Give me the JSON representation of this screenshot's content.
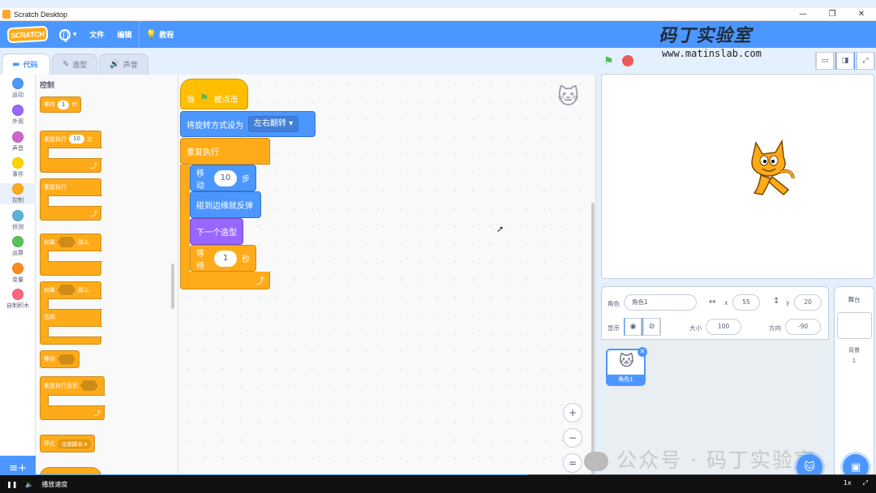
{
  "window": {
    "title": "Scratch Desktop",
    "controls": [
      "—",
      "❐",
      "✕"
    ]
  },
  "menubar": {
    "logo": "SCRATCH",
    "file": "文件",
    "edit": "编辑",
    "tutorials": "教程"
  },
  "watermark": {
    "brand": "码丁实验室",
    "url": "www.matinslab.com",
    "bottom": "公众号 · 码丁实验室"
  },
  "tabs": [
    {
      "label": "代码",
      "icon": "code-icon",
      "active": true
    },
    {
      "label": "造型",
      "icon": "brush-icon",
      "active": false
    },
    {
      "label": "声音",
      "icon": "speaker-icon",
      "active": false
    }
  ],
  "categories": [
    {
      "label": "运动",
      "color": "#4c97ff"
    },
    {
      "label": "外观",
      "color": "#9966ff"
    },
    {
      "label": "声音",
      "color": "#cf63cf"
    },
    {
      "label": "事件",
      "color": "#ffd500"
    },
    {
      "label": "控制",
      "color": "#ffab19"
    },
    {
      "label": "侦测",
      "color": "#5cb1d6"
    },
    {
      "label": "运算",
      "color": "#59c059"
    },
    {
      "label": "变量",
      "color": "#ff8c1a"
    },
    {
      "label": "自制积木",
      "color": "#ff6680"
    }
  ],
  "palette": {
    "title": "控制",
    "wait_label": "等待",
    "wait_value": "1",
    "wait_unit": "秒",
    "repeat_label": "重复执行",
    "repeat_value": "10",
    "repeat_unit": "次",
    "forever_label": "重复执行",
    "if_label": "如果",
    "then_label": "那么",
    "if2_label": "如果",
    "then2_label": "那么",
    "else_label": "否则",
    "wait_until_label": "等待",
    "repeat_until_label": "重复执行直到",
    "stop_label": "停止",
    "stop_option": "全部脚本"
  },
  "script": {
    "when_label": "当",
    "clicked_label": "被点击",
    "rotation_label": "将旋转方式设为",
    "rotation_option": "左右翻转",
    "forever_label": "重复执行",
    "move_label": "移动",
    "move_value": "10",
    "move_unit": "步",
    "bounce_label": "碰到边缘就反弹",
    "next_costume_label": "下一个造型",
    "wait_label": "等待",
    "wait_value": "1",
    "wait_unit": "秒"
  },
  "zoom": {
    "in": "+",
    "out": "−",
    "reset": "="
  },
  "sprite": {
    "name_label": "角色",
    "name_value": "角色1",
    "x_label": "x",
    "x_value": "55",
    "y_label": "y",
    "y_value": "20",
    "show_label": "显示",
    "size_label": "大小",
    "size_value": "100",
    "direction_label": "方向",
    "direction_value": "-90",
    "thumb_name": "角色1"
  },
  "stage_panel": {
    "title": "舞台",
    "backdrop_label": "背景",
    "backdrop_count": "1"
  },
  "video": {
    "time": "播放速度"
  }
}
